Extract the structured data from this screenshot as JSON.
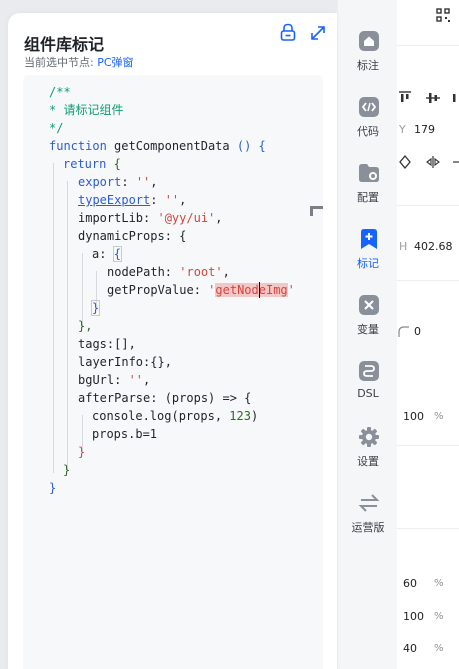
{
  "card": {
    "title": "组件库标记",
    "subtitle_prefix": "当前选中节点:",
    "selected_node": "PC弹窗"
  },
  "code": {
    "l1": "/**",
    "l2": "* 请标记组件",
    "l3": "*/",
    "l4_kw": "function",
    "l4_name": " getComponentData ",
    "l4_paren": "()",
    "l4_brace": " {",
    "l5_kw": "return",
    "l5_brace": " {",
    "l6_key": "export",
    "l6_colon": ": ",
    "l6_val": "''",
    "l6_comma": ",",
    "l7_key": "typeExport",
    "l7_colon": ": ",
    "l7_val": "''",
    "l7_comma": ",",
    "l8_key": "importLib",
    "l8_colon": ": ",
    "l8_val": "'@yy/ui'",
    "l8_comma": ",",
    "l9_key": "dynamicProps",
    "l9_rest": ": {",
    "l10_key": "a",
    "l10_colon": ": ",
    "l10_brace": "{",
    "l11_key": "nodePath",
    "l11_colon": ": ",
    "l11_val": "'root'",
    "l11_comma": ",",
    "l12_key": "getPropValue",
    "l12_colon": ": ",
    "l12_q1": "'",
    "l12_val": "getNodeImg",
    "l12_q2": "'",
    "l13": "}",
    "l14": "},",
    "l15_key": "tags",
    "l15_rest": ":[],",
    "l16_key": "layerInfo",
    "l16_rest": ":{},",
    "l17_key": "bgUrl",
    "l17_colon": ": ",
    "l17_val": "''",
    "l17_comma": ",",
    "l18_key": "afterParse",
    "l18_colon": ": ",
    "l18_args": "(props)",
    "l18_arrow": " => {",
    "l19_obj": "console.log",
    "l19_args": "(props, ",
    "l19_num": "123",
    "l19_close": ")",
    "l20": "props.b=1",
    "l21": "}",
    "l22": "}",
    "l23": "}"
  },
  "toolbar": {
    "items": [
      {
        "label": "标注",
        "icon": "home-icon"
      },
      {
        "label": "代码",
        "icon": "code-icon"
      },
      {
        "label": "配置",
        "icon": "folder-settings-icon"
      },
      {
        "label": "标记",
        "icon": "bookmark-add-icon",
        "active": true
      },
      {
        "label": "变量",
        "icon": "variable-icon"
      },
      {
        "label": "DSL",
        "icon": "dsl-icon"
      },
      {
        "label": "设置",
        "icon": "gear-icon"
      },
      {
        "label": "运营版",
        "icon": "switch-arrows-icon"
      }
    ]
  },
  "props": {
    "y_label": "Y",
    "y_value": "179",
    "h_label": "H",
    "h_value": "402.68",
    "radius_value": "0",
    "opacity_value": "100",
    "opacity_unit": "%",
    "v1": "60",
    "v1_unit": "%",
    "v2": "100",
    "v2_unit": "%",
    "v3": "40",
    "v3_unit": "%"
  },
  "colors": {
    "accent": "#1763ff",
    "comment": "#0e9f6e",
    "keyword": "#2b5cd6",
    "string": "#d4453e"
  }
}
